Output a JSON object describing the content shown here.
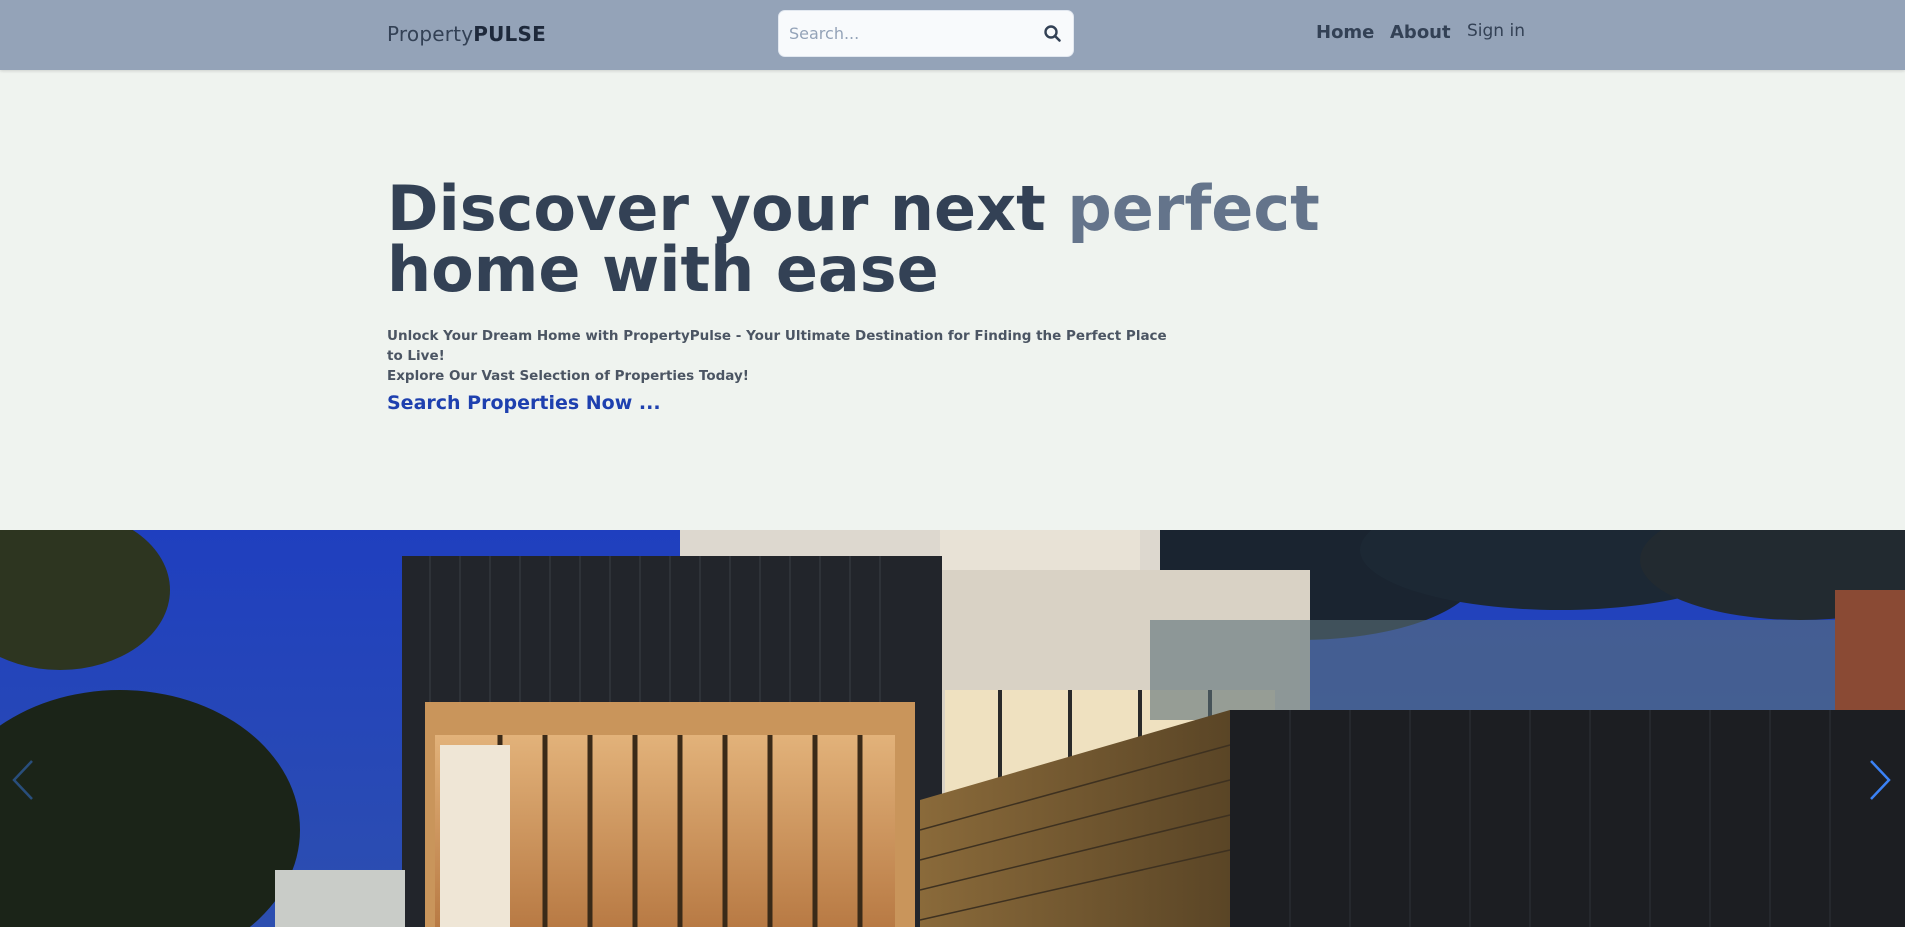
{
  "navbar": {
    "brand_part1": "Property",
    "brand_part2": "PULSE",
    "search_placeholder": "Search...",
    "links": {
      "home": "Home",
      "about": "About",
      "signin": "Sign in"
    }
  },
  "hero": {
    "title_part1": "Discover your next ",
    "title_accent": "perfect",
    "title_part2": "home with ease",
    "subtitle_line1": "Unlock Your Dream Home with PropertyPulse - Your Ultimate Destination for Finding the Perfect Place to Live!",
    "subtitle_line2": "Explore Our Vast Selection of Properties Today!",
    "cta": "Search Properties Now ..."
  },
  "icons": {
    "search": "search-icon",
    "prev": "chevron-left-icon",
    "next": "chevron-right-icon"
  },
  "colors": {
    "navbar_bg": "#94a3b8",
    "page_bg": "#eff3ef",
    "title": "#334155",
    "title_accent": "#64748b",
    "cta": "#1e40af",
    "arrow": "#3b82f6"
  }
}
